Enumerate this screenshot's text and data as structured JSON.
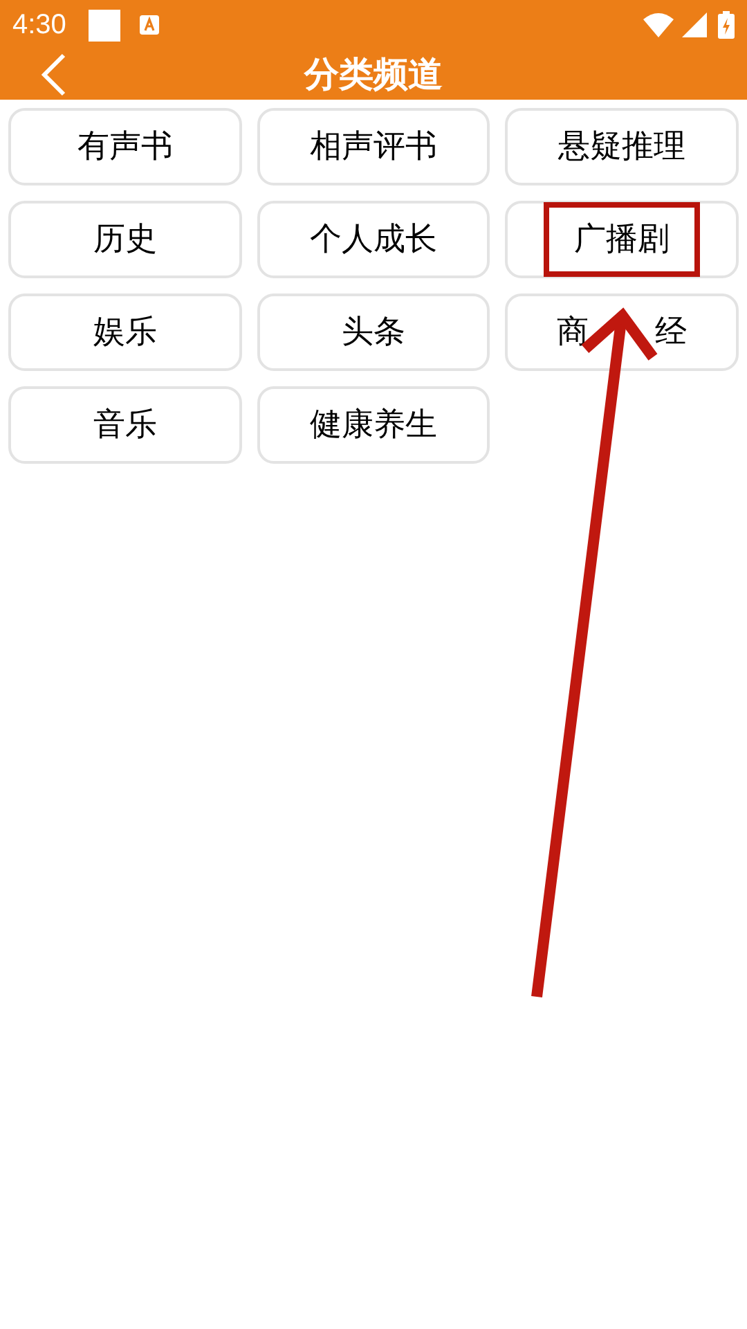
{
  "status_bar": {
    "time": "4:30"
  },
  "header": {
    "title": "分类频道"
  },
  "categories": [
    {
      "label": "有声书",
      "highlighted": false
    },
    {
      "label": "相声评书",
      "highlighted": false
    },
    {
      "label": "悬疑推理",
      "highlighted": false
    },
    {
      "label": "历史",
      "highlighted": false
    },
    {
      "label": "个人成长",
      "highlighted": false
    },
    {
      "label": "广播剧",
      "highlighted": true
    },
    {
      "label": "娱乐",
      "highlighted": false
    },
    {
      "label": "头条",
      "highlighted": false
    },
    {
      "label_parts": [
        "商",
        "经"
      ],
      "highlighted": false
    },
    {
      "label": "音乐",
      "highlighted": false
    },
    {
      "label": "健康养生",
      "highlighted": false
    }
  ]
}
